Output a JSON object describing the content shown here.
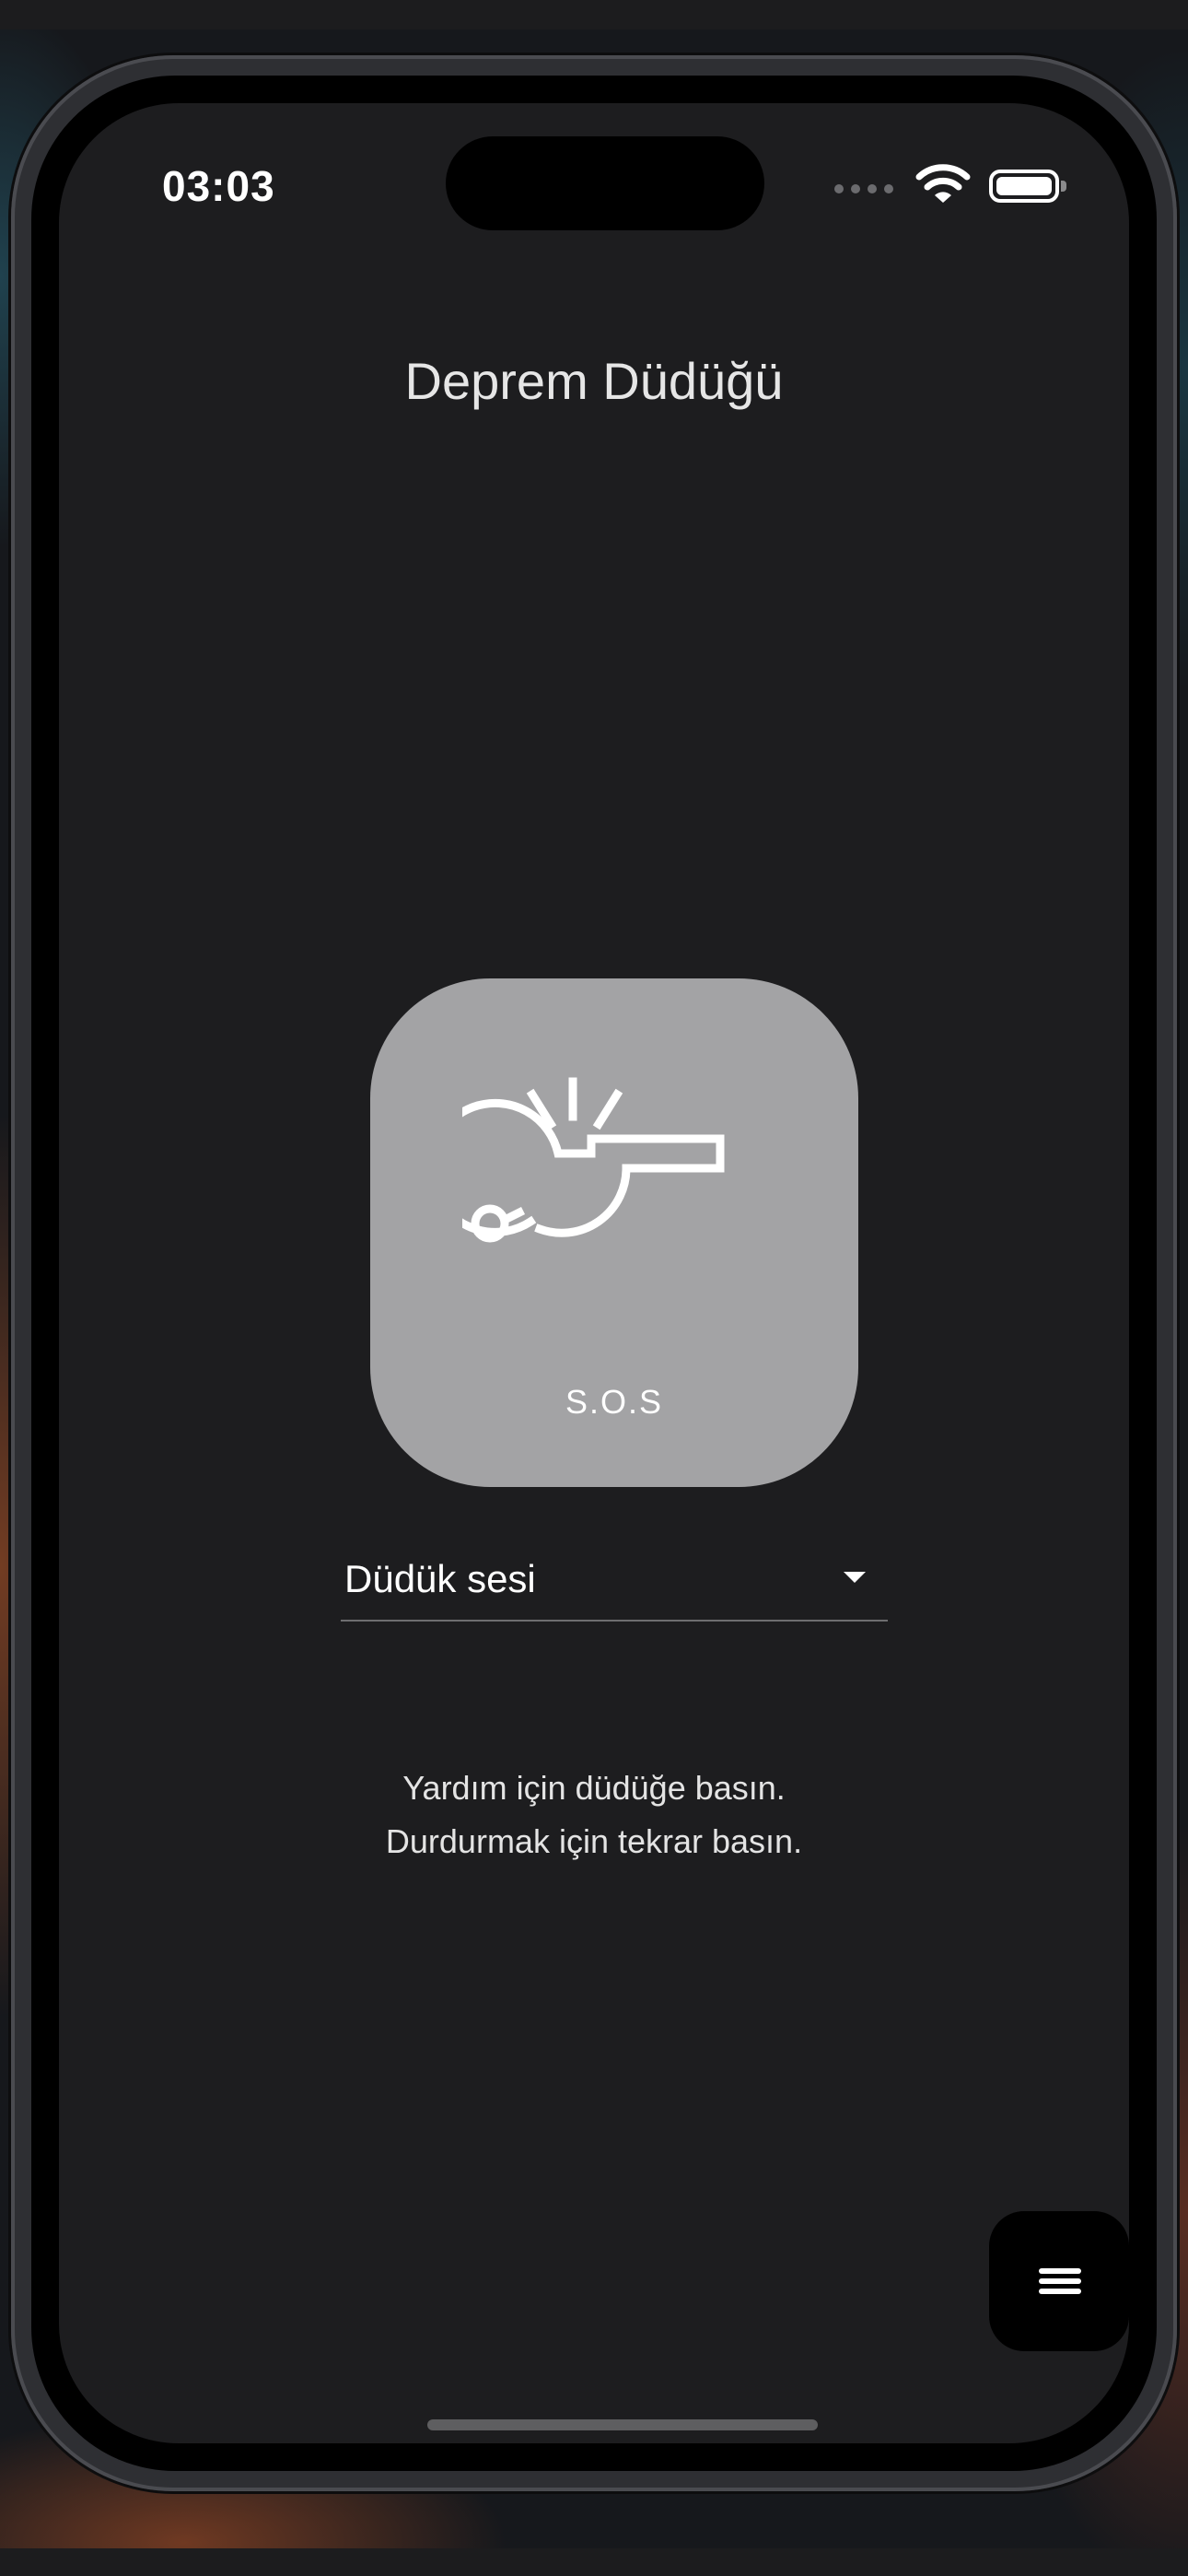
{
  "status_bar": {
    "time": "03:03",
    "icons": [
      "cellular-signal-icon",
      "wifi-icon",
      "battery-icon"
    ]
  },
  "app": {
    "title": "Deprem Düdüğü"
  },
  "sos_button": {
    "icon": "whistle-icon",
    "label": "S.O.S"
  },
  "sound_select": {
    "selected_value": "Düdük sesi",
    "icon": "chevron-down-icon"
  },
  "instructions": {
    "line1": "Yardım için düdüğe basın.",
    "line2": "Durdurmak için tekrar basın."
  },
  "fab": {
    "icon": "menu-icon"
  },
  "colors": {
    "background": "#1d1d1f",
    "sos_button": "#a3a3a5",
    "text": "#ffffff",
    "fab": "#000000"
  }
}
